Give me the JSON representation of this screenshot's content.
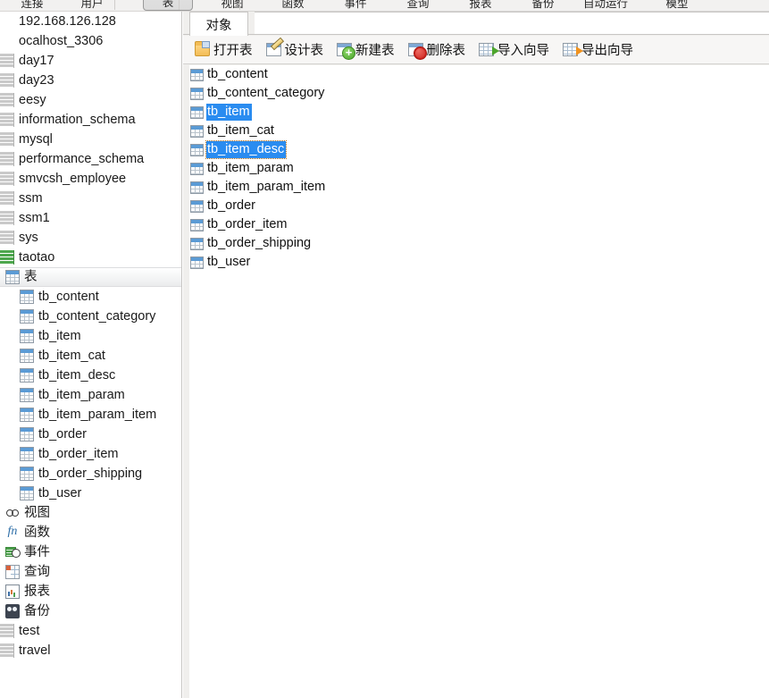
{
  "app": {
    "accent_selection": "#2a8cf0",
    "focus_outline": "#b06a14"
  },
  "top_toolbar": {
    "note": "toolbar row cut off at top of screenshot; only bottom pixels of labels visible",
    "items": [
      {
        "label": "连接",
        "pressed": false
      },
      {
        "label": "用户",
        "pressed": false
      },
      {
        "label": "表",
        "pressed": true
      },
      {
        "label": "视图",
        "pressed": false
      },
      {
        "label": "函数",
        "pressed": false
      },
      {
        "label": "事件",
        "pressed": false
      },
      {
        "label": "查询",
        "pressed": false
      },
      {
        "label": "报表",
        "pressed": false
      },
      {
        "label": "备份",
        "pressed": false
      },
      {
        "label": "自动运行",
        "pressed": false
      },
      {
        "label": "模型",
        "pressed": false
      }
    ]
  },
  "sidebar": {
    "items": [
      {
        "label": "192.168.126.128",
        "level": 0,
        "icon": "connection-icon",
        "state": "closed",
        "selected": false
      },
      {
        "label": "ocalhost_3306",
        "level": 0,
        "icon": "connection-icon",
        "state": "closed",
        "selected": false
      },
      {
        "label": "day17",
        "level": 1,
        "icon": "database-icon",
        "state": "closed",
        "selected": false
      },
      {
        "label": "day23",
        "level": 1,
        "icon": "database-icon",
        "state": "closed",
        "selected": false
      },
      {
        "label": "eesy",
        "level": 1,
        "icon": "database-icon",
        "state": "closed",
        "selected": false
      },
      {
        "label": "information_schema",
        "level": 1,
        "icon": "database-icon",
        "state": "closed",
        "selected": false
      },
      {
        "label": "mysql",
        "level": 1,
        "icon": "database-icon",
        "state": "closed",
        "selected": false
      },
      {
        "label": "performance_schema",
        "level": 1,
        "icon": "database-icon",
        "state": "closed",
        "selected": false
      },
      {
        "label": "smvcsh_employee",
        "level": 1,
        "icon": "database-icon",
        "state": "closed",
        "selected": false
      },
      {
        "label": "ssm",
        "level": 1,
        "icon": "database-icon",
        "state": "closed",
        "selected": false
      },
      {
        "label": "ssm1",
        "level": 1,
        "icon": "database-icon",
        "state": "closed",
        "selected": false
      },
      {
        "label": "sys",
        "level": 1,
        "icon": "database-icon",
        "state": "closed",
        "selected": false
      },
      {
        "label": "taotao",
        "level": 1,
        "icon": "database-icon",
        "state": "open",
        "selected": false
      },
      {
        "label": "表",
        "level": 2,
        "icon": "tables-folder-icon",
        "state": "open",
        "selected": true
      },
      {
        "label": "tb_content",
        "level": 3,
        "icon": "table-icon",
        "selected": false
      },
      {
        "label": "tb_content_category",
        "level": 3,
        "icon": "table-icon",
        "selected": false
      },
      {
        "label": "tb_item",
        "level": 3,
        "icon": "table-icon",
        "selected": false
      },
      {
        "label": "tb_item_cat",
        "level": 3,
        "icon": "table-icon",
        "selected": false
      },
      {
        "label": "tb_item_desc",
        "level": 3,
        "icon": "table-icon",
        "selected": false
      },
      {
        "label": "tb_item_param",
        "level": 3,
        "icon": "table-icon",
        "selected": false
      },
      {
        "label": "tb_item_param_item",
        "level": 3,
        "icon": "table-icon",
        "selected": false
      },
      {
        "label": "tb_order",
        "level": 3,
        "icon": "table-icon",
        "selected": false
      },
      {
        "label": "tb_order_item",
        "level": 3,
        "icon": "table-icon",
        "selected": false
      },
      {
        "label": "tb_order_shipping",
        "level": 3,
        "icon": "table-icon",
        "selected": false
      },
      {
        "label": "tb_user",
        "level": 3,
        "icon": "table-icon",
        "selected": false
      },
      {
        "label": "视图",
        "level": 2,
        "icon": "views-icon",
        "selected": false
      },
      {
        "label": "函数",
        "level": 2,
        "icon": "function-icon",
        "selected": false
      },
      {
        "label": "事件",
        "level": 2,
        "icon": "event-icon",
        "selected": false
      },
      {
        "label": "查询",
        "level": 2,
        "icon": "query-icon",
        "selected": false
      },
      {
        "label": "报表",
        "level": 2,
        "icon": "report-icon",
        "selected": false
      },
      {
        "label": "备份",
        "level": 2,
        "icon": "backup-icon",
        "selected": false
      },
      {
        "label": "test",
        "level": 1,
        "icon": "database-icon",
        "state": "closed",
        "selected": false
      },
      {
        "label": "travel",
        "level": 1,
        "icon": "database-icon",
        "state": "closed",
        "selected": false
      }
    ]
  },
  "right_pane": {
    "tabs": [
      {
        "label": "对象",
        "active": true
      }
    ],
    "toolbar": [
      {
        "label": "打开表",
        "icon": "open-table-icon"
      },
      {
        "label": "设计表",
        "icon": "design-table-icon"
      },
      {
        "label": "新建表",
        "icon": "new-table-icon"
      },
      {
        "label": "删除表",
        "icon": "delete-table-icon"
      },
      {
        "label": "导入向导",
        "icon": "import-wizard-icon"
      },
      {
        "label": "导出向导",
        "icon": "export-wizard-icon"
      }
    ],
    "object_list": [
      {
        "name": "tb_content",
        "icon": "table-icon",
        "selected": false,
        "focused": false
      },
      {
        "name": "tb_content_category",
        "icon": "table-icon",
        "selected": false,
        "focused": false
      },
      {
        "name": "tb_item",
        "icon": "table-icon",
        "selected": true,
        "focused": false
      },
      {
        "name": "tb_item_cat",
        "icon": "table-icon",
        "selected": false,
        "focused": false
      },
      {
        "name": "tb_item_desc",
        "icon": "table-icon",
        "selected": true,
        "focused": true
      },
      {
        "name": "tb_item_param",
        "icon": "table-icon",
        "selected": false,
        "focused": false
      },
      {
        "name": "tb_item_param_item",
        "icon": "table-icon",
        "selected": false,
        "focused": false
      },
      {
        "name": "tb_order",
        "icon": "table-icon",
        "selected": false,
        "focused": false
      },
      {
        "name": "tb_order_item",
        "icon": "table-icon",
        "selected": false,
        "focused": false
      },
      {
        "name": "tb_order_shipping",
        "icon": "table-icon",
        "selected": false,
        "focused": false
      },
      {
        "name": "tb_user",
        "icon": "table-icon",
        "selected": false,
        "focused": false
      }
    ]
  }
}
